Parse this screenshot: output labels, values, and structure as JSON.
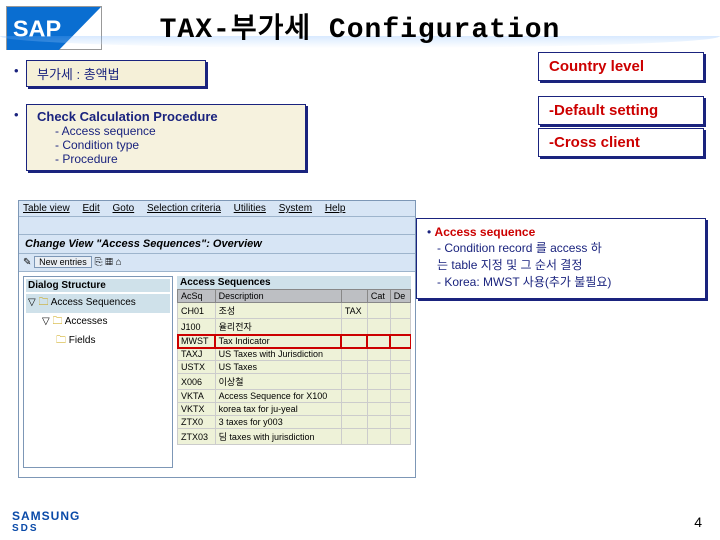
{
  "header": {
    "title": "TAX-부가세 Configuration"
  },
  "bullets": {
    "b1": "부가세 : 총액법",
    "b2_title": "Check Calculation Procedure",
    "b2_items": [
      "Access sequence",
      "Condition type",
      "Procedure"
    ]
  },
  "right": {
    "r1": "Country level",
    "r2": "-Default setting",
    "r3": "-Cross client"
  },
  "note": {
    "title": "Access sequence",
    "l1": "- Condition record 를 access 하",
    "l2": "는 table 지정 및 그 순서 결정",
    "l3": "- Korea: MWST 사용(추가 불필요)"
  },
  "sap": {
    "menu": [
      "Table view",
      "Edit",
      "Goto",
      "Selection criteria",
      "Utilities",
      "System",
      "Help"
    ],
    "change_title": "Change View \"Access Sequences\": Overview",
    "new_entries": "New entries",
    "tree_header": "Dialog Structure",
    "tree": [
      "Access Sequences",
      "Accesses",
      "Fields"
    ],
    "table_title": "Access Sequences",
    "cols": [
      "AcSq",
      "Description",
      "",
      "Cat",
      "De"
    ],
    "rows": [
      [
        "CH01",
        "조성",
        "TAX",
        "",
        ""
      ],
      [
        "J100",
        "율리전자",
        "",
        "",
        ""
      ],
      [
        "MWST",
        "Tax Indicator",
        "",
        "",
        ""
      ],
      [
        "TAXJ",
        "US Taxes with Jurisdiction",
        "",
        "",
        ""
      ],
      [
        "USTX",
        "US Taxes",
        "",
        "",
        ""
      ],
      [
        "X006",
        "이상철",
        "",
        "",
        ""
      ],
      [
        "VKTA",
        "Access Sequence for X100",
        "",
        "",
        ""
      ],
      [
        "VKTX",
        "korea tax for ju-yeal",
        "",
        "",
        ""
      ],
      [
        "ZTX0",
        "3 taxes for y003",
        "",
        "",
        ""
      ],
      [
        "ZTX03",
        "딤 taxes with jurisdiction",
        "",
        "",
        ""
      ]
    ],
    "highlight_index": 2
  },
  "footer": {
    "brand": "SAMSUNG",
    "sub": "SDS",
    "page": "4"
  }
}
